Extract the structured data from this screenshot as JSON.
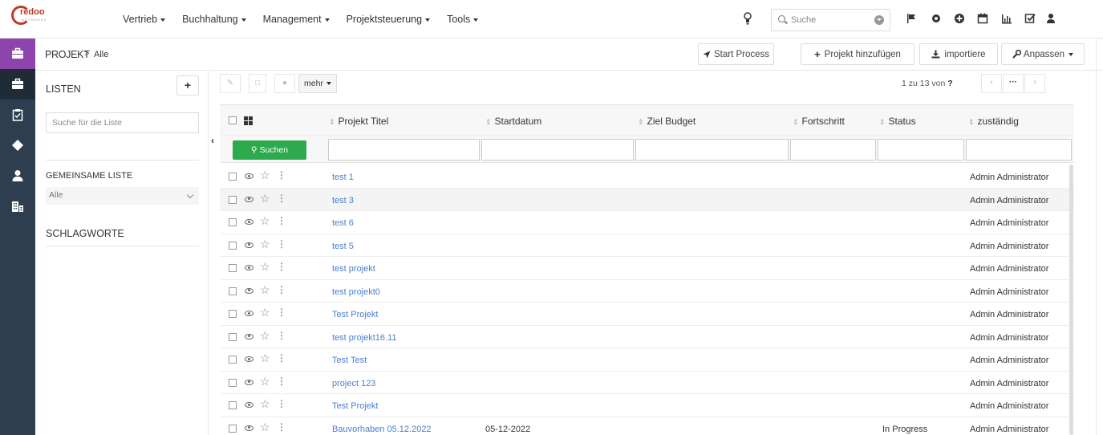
{
  "brand": {
    "name": "redoo",
    "tagline": "NETWORKS"
  },
  "nav": {
    "menu": [
      "Vertrieb",
      "Buchhaltung",
      "Management",
      "Projektsteuerung",
      "Tools"
    ],
    "search_placeholder": "Suche"
  },
  "breadcrumb": {
    "title": "PROJEKT",
    "separator": ">",
    "sub": "Alle"
  },
  "actions": {
    "start_process": "Start Process",
    "add_project": "Projekt hinzufügen",
    "import": "importiere",
    "customize": "Anpassen"
  },
  "lists": {
    "title": "LISTEN",
    "add": "+",
    "search_placeholder": "Suche für die Liste",
    "shared_title": "GEMEINSAME LISTE",
    "shared_value": "Alle",
    "tags_title": "SCHLAGWORTE"
  },
  "toolbar": {
    "more": "mehr"
  },
  "pager": {
    "text": "1 zu 13 von",
    "total": "?",
    "more": "···"
  },
  "table": {
    "search_button": "Suchen",
    "columns": [
      "Projekt Titel",
      "Startdatum",
      "Ziel Budget",
      "Fortschritt",
      "Status",
      "zuständig"
    ],
    "rows": [
      {
        "title": "test 1",
        "start": "",
        "budget": "",
        "progress": "",
        "status": "",
        "owner": "Admin Administrator"
      },
      {
        "title": "test 3",
        "start": "",
        "budget": "",
        "progress": "",
        "status": "",
        "owner": "Admin Administrator"
      },
      {
        "title": "test 6",
        "start": "",
        "budget": "",
        "progress": "",
        "status": "",
        "owner": "Admin Administrator"
      },
      {
        "title": "test 5",
        "start": "",
        "budget": "",
        "progress": "",
        "status": "",
        "owner": "Admin Administrator"
      },
      {
        "title": "test projekt",
        "start": "",
        "budget": "",
        "progress": "",
        "status": "",
        "owner": "Admin Administrator"
      },
      {
        "title": "test projekt0",
        "start": "",
        "budget": "",
        "progress": "",
        "status": "",
        "owner": "Admin Administrator"
      },
      {
        "title": "Test Projekt",
        "start": "",
        "budget": "",
        "progress": "",
        "status": "",
        "owner": "Admin Administrator"
      },
      {
        "title": "test projekt16.11",
        "start": "",
        "budget": "",
        "progress": "",
        "status": "",
        "owner": "Admin Administrator"
      },
      {
        "title": "Test Test",
        "start": "",
        "budget": "",
        "progress": "",
        "status": "",
        "owner": "Admin Administrator"
      },
      {
        "title": "project 123",
        "start": "",
        "budget": "",
        "progress": "",
        "status": "",
        "owner": "Admin Administrator"
      },
      {
        "title": "Test Projekt",
        "start": "",
        "budget": "",
        "progress": "",
        "status": "",
        "owner": "Admin Administrator"
      },
      {
        "title": "Bauvorhaben 05.12.2022",
        "start": "05-12-2022",
        "budget": "",
        "progress": "",
        "status": "In Progress",
        "owner": "Admin Administrator"
      }
    ]
  },
  "icons": {
    "sidebar": [
      "briefcase-icon",
      "briefcase-dark-icon",
      "clipboard-icon",
      "diamond-icon",
      "user-icon",
      "building-icon"
    ],
    "topbar": [
      "lightbulb-icon",
      "flag-icon",
      "gear-icon",
      "plus-circle-icon",
      "calendar-icon",
      "chart-icon",
      "checkbox-icon",
      "user-icon"
    ]
  },
  "colors": {
    "accent": "#8e44ad",
    "sidebar": "#2f3e4e",
    "link": "#4a7fd0",
    "search_button": "#2eaa4e",
    "brand": "#c0392b"
  }
}
